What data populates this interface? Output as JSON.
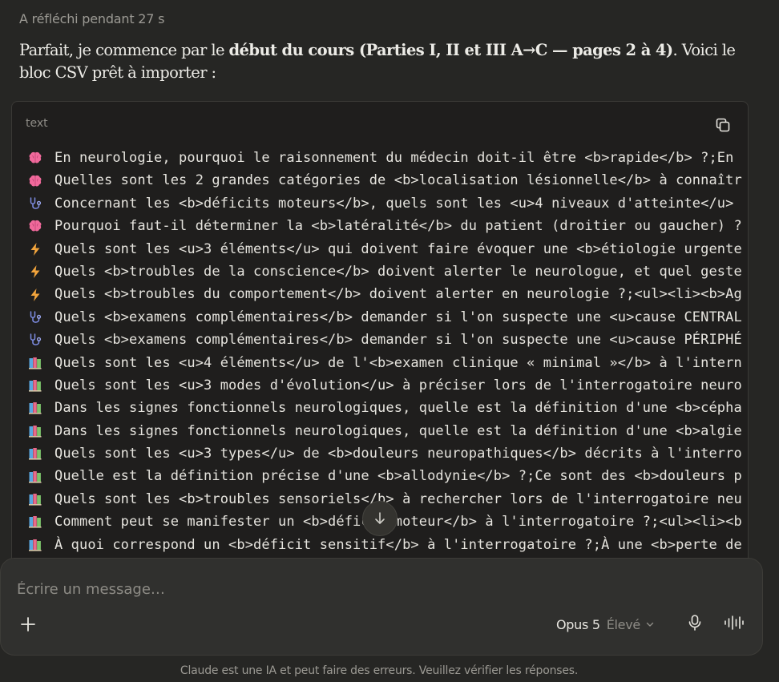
{
  "thought_label": "A réfléchi pendant 27 s",
  "intro": {
    "part1": "Parfait, je commence par le ",
    "bold": "début du cours (Parties I, II et III A→C — pages 2 à 4)",
    "part2": ". Voici le bloc CSV prêt à importer :"
  },
  "code_block": {
    "language": "text",
    "lines": [
      {
        "icon": "brain-icon",
        "text": "En neurologie, pourquoi le raisonnement du médecin doit-il être <b>rapide</b> ?;En"
      },
      {
        "icon": "brain-icon",
        "text": "Quelles sont les 2 grandes catégories de <b>localisation lésionnelle</b> à connaîtr"
      },
      {
        "icon": "stethoscope-icon",
        "text": "Concernant les <b>déficits moteurs</b>, quels sont les <u>4 niveaux d'atteinte</u>"
      },
      {
        "icon": "brain-icon",
        "text": "Pourquoi faut-il déterminer la <b>latéralité</b> du patient (droitier ou gaucher) ?"
      },
      {
        "icon": "lightning-icon",
        "text": "Quels sont les <u>3 éléments</u> qui doivent faire évoquer une <b>étiologie urgente"
      },
      {
        "icon": "lightning-icon",
        "text": "Quels <b>troubles de la conscience</b> doivent alerter le neurologue, et quel geste"
      },
      {
        "icon": "lightning-icon",
        "text": "Quels <b>troubles du comportement</b> doivent alerter en neurologie ?;<ul><li><b>Ag"
      },
      {
        "icon": "stethoscope-icon",
        "text": "Quels <b>examens complémentaires</b> demander si l'on suspecte une <u>cause CENTRAL"
      },
      {
        "icon": "stethoscope-icon",
        "text": "Quels <b>examens complémentaires</b> demander si l'on suspecte une <u>cause PÉRIPHÉ"
      },
      {
        "icon": "books-icon",
        "text": "Quels sont les <u>4 éléments</u> de l'<b>examen clinique « minimal »</b> à l'intern"
      },
      {
        "icon": "books-icon",
        "text": "Quels sont les <u>3 modes d'évolution</u> à préciser lors de l'interrogatoire neuro"
      },
      {
        "icon": "books-icon",
        "text": "Dans les signes fonctionnels neurologiques, quelle est la définition d'une <b>cépha"
      },
      {
        "icon": "books-icon",
        "text": "Dans les signes fonctionnels neurologiques, quelle est la définition d'une <b>algie"
      },
      {
        "icon": "books-icon",
        "text": "Quels sont les <u>3 types</u> de <b>douleurs neuropathiques</b> décrits à l'interro"
      },
      {
        "icon": "books-icon",
        "text": "Quelle est la définition précise d'une <b>allodynie</b> ?;Ce sont des <b>douleurs p"
      },
      {
        "icon": "books-icon",
        "text": "Quels sont les <b>troubles sensoriels</b> à rechercher lors de l'interrogatoire neu"
      },
      {
        "icon": "books-icon",
        "text": "Comment peut se manifester un <b>déficit moteur</b> à l'interrogatoire ?;<ul><li><b"
      },
      {
        "icon": "books-icon",
        "text": "À quoi correspond un <b>déficit sensitif</b> à l'interrogatoire ?;À une <b>perte de"
      }
    ]
  },
  "composer": {
    "placeholder": "Écrire un message…",
    "model_name": "Opus 5",
    "effort": "Élevé"
  },
  "disclaimer": "Claude est une IA et peut faire des erreurs. Veuillez vérifier les réponses.",
  "colors": {
    "background": "#262624",
    "code_background": "#1f1e1d",
    "composer_background": "#30302e",
    "brain_pink": "#f0699b",
    "stethoscope_blue": "#7f8ee6",
    "lightning_orange": "#f2a43c"
  }
}
